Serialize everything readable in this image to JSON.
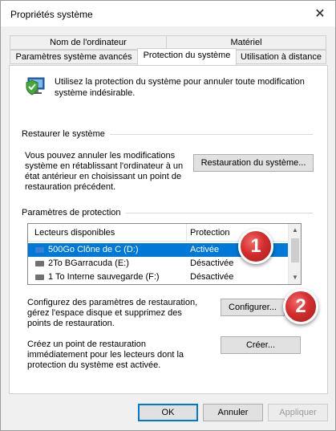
{
  "window": {
    "title": "Propriétés système"
  },
  "tabs": {
    "row1": [
      "Nom de l'ordinateur",
      "Matériel"
    ],
    "row2": [
      "Paramètres système avancés",
      "Protection du système",
      "Utilisation à distance"
    ]
  },
  "intro_text": "Utilisez la protection du système pour annuler toute modification système indésirable.",
  "restore": {
    "group_label": "Restaurer le système",
    "description": "Vous pouvez annuler les modifications système en rétablissant l'ordinateur à un état antérieur en choisissant un point de restauration précédent.",
    "button_label": "Restauration du système..."
  },
  "protection": {
    "group_label": "Paramètres de protection",
    "columns": [
      "Lecteurs disponibles",
      "Protection"
    ],
    "rows": [
      {
        "name": "500Go Clône de C (D:)",
        "status": "Activée",
        "selected": true,
        "drive_color": "#3a7fd0"
      },
      {
        "name": "2To BGarracuda (E:)",
        "status": "Désactivée",
        "selected": false,
        "drive_color": "#707070"
      },
      {
        "name": "1 To Interne sauvegarde (F:)",
        "status": "Désactivée",
        "selected": false,
        "drive_color": "#707070"
      }
    ]
  },
  "configure": {
    "description": "Configurez des paramètres de restauration, gérez l'espace disque et supprimez des points de restauration.",
    "button_label": "Configurer..."
  },
  "create": {
    "description": "Créez un point de restauration immédiatement pour les lecteurs dont la protection du système est activée.",
    "button_label": "Créer..."
  },
  "footer": {
    "ok": "OK",
    "cancel": "Annuler",
    "apply": "Appliquer"
  },
  "badges": [
    "1",
    "2"
  ],
  "icons": [
    "close-icon",
    "system-protection-shield-icon",
    "drive-icon",
    "scroll-up-icon",
    "scroll-down-icon"
  ],
  "colors": {
    "selection": "#0078d7",
    "badge": "#d42d2d",
    "default_button_border": "#0078d7"
  }
}
